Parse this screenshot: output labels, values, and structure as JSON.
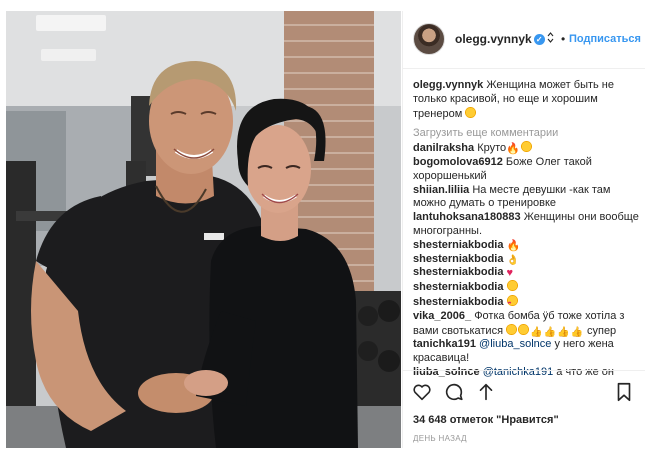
{
  "post": {
    "username": "olegg.vynnyk",
    "follow_label": "Подписаться",
    "dot": "•",
    "caption_user": "olegg.vynnyk",
    "caption_text": "Женщина может быть не только красивой, но еще и хорошим тренером",
    "load_more_label": "Загрузить еще комментарии",
    "likes_label": "34 648 отметок \"Нравится\"",
    "timestamp": "ДЕНЬ НАЗАД"
  },
  "comments": [
    {
      "user": "danilraksha",
      "text": "Круто",
      "emoji": [
        "fire",
        "smile"
      ]
    },
    {
      "user": "bogomolova6912",
      "text": "Боже Олег такой хороршенький",
      "emoji": []
    },
    {
      "user": "shiian.liliia",
      "text": "На месте девушки -как там можно думать о тренировке",
      "emoji": []
    },
    {
      "user": "lantuhoksana180883",
      "text": "Женщины они вообще многогранны.",
      "emoji": []
    },
    {
      "user": "shesterniakbodia",
      "text": "",
      "emoji": [
        "fire"
      ]
    },
    {
      "user": "shesterniakbodia",
      "text": "",
      "emoji": [
        "thumb"
      ]
    },
    {
      "user": "shesterniakbodia",
      "text": "",
      "emoji": [
        "heart"
      ]
    },
    {
      "user": "shesterniakbodia",
      "text": "",
      "emoji": [
        "smile"
      ]
    },
    {
      "user": "shesterniakbodia",
      "text": "",
      "emoji": [
        "love"
      ]
    },
    {
      "user": "vika_2006_",
      "text": "Фотка бомба ÿб тоже хотіла з вами свотькатися",
      "text_after": "супер",
      "emoji": [
        "smile",
        "smile",
        "thumb",
        "thumb",
        "thumb",
        "thumb"
      ]
    },
    {
      "user": "tanichka191",
      "mention": "@liuba_solnce",
      "text": "у него жена красавица!",
      "emoji": []
    },
    {
      "user": "liuba_solnce",
      "mention": "@tanichka191",
      "text": "а что же он",
      "emoji": []
    }
  ],
  "icons": {
    "verified": "verified-badge-icon",
    "dropdown": "dropdown-icon",
    "like": "heart-outline-icon",
    "comment": "comment-icon",
    "share": "share-icon",
    "save": "bookmark-icon"
  },
  "colors": {
    "link": "#3897f0",
    "text": "#262626",
    "muted": "#999999",
    "border": "#efefef",
    "mention": "#003569"
  }
}
